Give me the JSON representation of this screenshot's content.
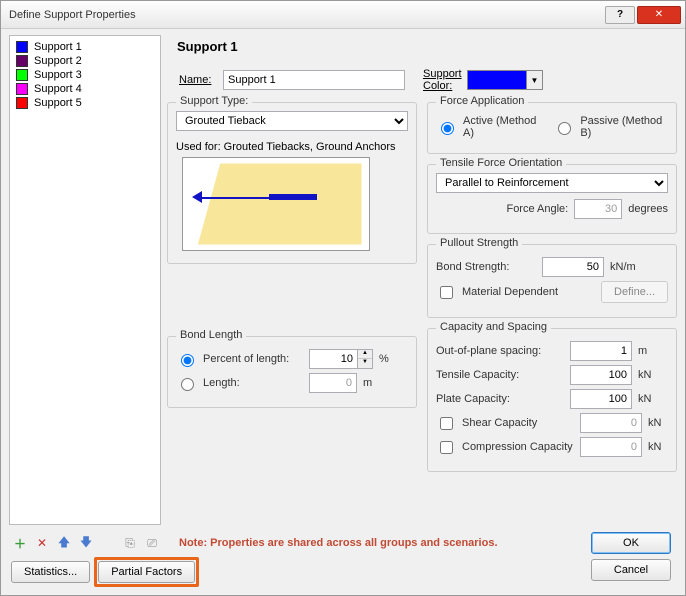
{
  "window": {
    "title": "Define Support Properties"
  },
  "supports": [
    {
      "label": "Support 1",
      "color": "#0000ff"
    },
    {
      "label": "Support 2",
      "color": "#660066"
    },
    {
      "label": "Support 3",
      "color": "#00ff00"
    },
    {
      "label": "Support 4",
      "color": "#ff00ff"
    },
    {
      "label": "Support 5",
      "color": "#ff0000"
    }
  ],
  "current": {
    "header": "Support 1",
    "name_label": "Name:",
    "name_value": "Support 1",
    "support_color_label": "Support Color:",
    "color": "#0000ff"
  },
  "support_type": {
    "legend": "Support Type:",
    "value": "Grouted Tieback",
    "used_for": "Used for: Grouted Tiebacks, Ground Anchors"
  },
  "force_app": {
    "legend": "Force Application",
    "active_label": "Active (Method A)",
    "passive_label": "Passive (Method B)"
  },
  "tensile": {
    "legend": "Tensile Force Orientation",
    "value": "Parallel to Reinforcement",
    "angle_label": "Force Angle:",
    "angle_value": "30",
    "angle_unit": "degrees"
  },
  "pullout": {
    "legend": "Pullout Strength",
    "bond_label": "Bond Strength:",
    "bond_value": "50",
    "bond_unit": "kN/m",
    "matdep_label": "Material Dependent",
    "define_label": "Define..."
  },
  "bondlen": {
    "legend": "Bond Length",
    "percent_label": "Percent of length:",
    "percent_value": "10",
    "percent_unit": "%",
    "length_label": "Length:",
    "length_value": "0",
    "length_unit": "m"
  },
  "capspacing": {
    "legend": "Capacity and Spacing",
    "oop_label": "Out-of-plane spacing:",
    "oop_value": "1",
    "oop_unit": "m",
    "tens_label": "Tensile Capacity:",
    "tens_value": "100",
    "tens_unit": "kN",
    "plate_label": "Plate Capacity:",
    "plate_value": "100",
    "plate_unit": "kN",
    "shear_label": "Shear Capacity",
    "shear_value": "0",
    "shear_unit": "kN",
    "comp_label": "Compression Capacity",
    "comp_value": "0",
    "comp_unit": "kN"
  },
  "note": "Note: Properties are shared across all groups and scenarios.",
  "buttons": {
    "statistics": "Statistics...",
    "partial_factors": "Partial Factors",
    "ok": "OK",
    "cancel": "Cancel"
  },
  "icons": {
    "add": "＋",
    "delete": "✕",
    "up": "🡅",
    "down": "🡇",
    "copy": "⎘",
    "filter": "⎚"
  }
}
